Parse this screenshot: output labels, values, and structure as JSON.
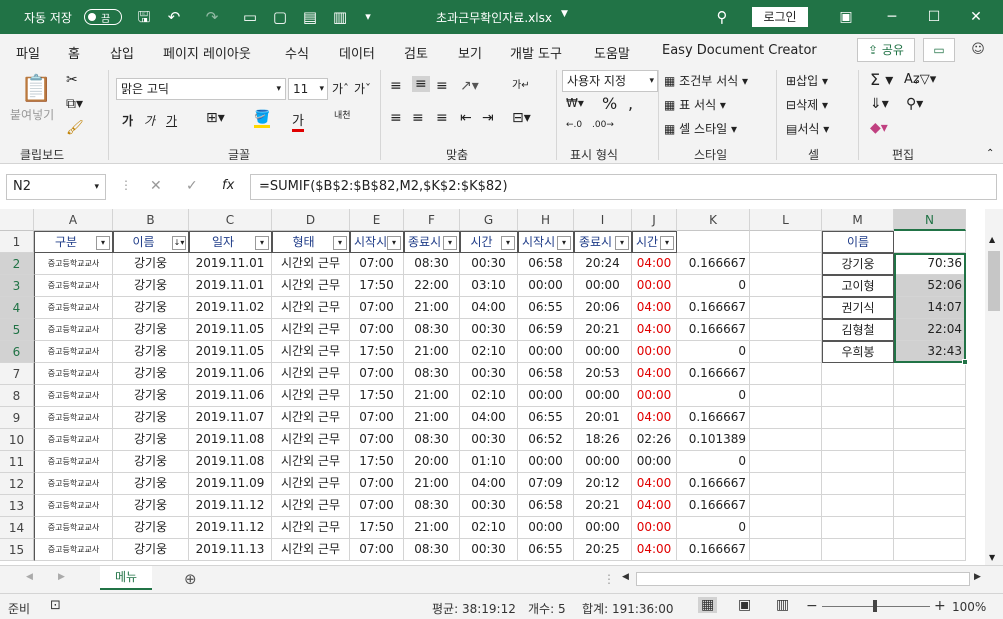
{
  "titlebar": {
    "autosave_label": "자동 저장",
    "autosave_state": "끔",
    "filename": "초과근무확인자료.xlsx",
    "login": "로그인"
  },
  "tabs": [
    "파일",
    "홈",
    "삽입",
    "페이지 레이아웃",
    "수식",
    "데이터",
    "검토",
    "보기",
    "개발 도구",
    "도움말",
    "Easy Document Creator"
  ],
  "share": "공유",
  "ribbon": {
    "paste": "붙여넣기",
    "font_name": "맑은 고딕",
    "font_size": "11",
    "bold": "가",
    "italic": "가",
    "underline": "가",
    "number_format": "사용자 지정",
    "cond_format": "조건부 서식",
    "table_format": "표 서식",
    "cell_style": "셀 스타일",
    "insert": "삽입",
    "delete": "삭제",
    "format": "서식",
    "groups": [
      "클립보드",
      "글꼴",
      "맞춤",
      "표시 형식",
      "스타일",
      "셀",
      "편집"
    ]
  },
  "formula": {
    "name_box": "N2",
    "content": "=SUMIF($B$2:$B$82,M2,$K$2:$K$82)"
  },
  "columns": [
    "A",
    "B",
    "C",
    "D",
    "E",
    "F",
    "G",
    "H",
    "I",
    "J",
    "K",
    "L",
    "M",
    "N"
  ],
  "headers": [
    "구분",
    "이름",
    "일자",
    "형태",
    "시작시",
    "종료시",
    "시간",
    "시작시",
    "종료시",
    "시간"
  ],
  "rows": [
    [
      "증고등학교교사",
      "강기웅",
      "2019.11.01",
      "시간외 근무",
      "07:00",
      "08:30",
      "00:30",
      "06:58",
      "20:24",
      "04:00",
      "0.166667"
    ],
    [
      "증고등학교교사",
      "강기웅",
      "2019.11.01",
      "시간외 근무",
      "17:50",
      "22:00",
      "03:10",
      "00:00",
      "00:00",
      "00:00",
      "0"
    ],
    [
      "증고등학교교사",
      "강기웅",
      "2019.11.02",
      "시간외 근무",
      "07:00",
      "21:00",
      "04:00",
      "06:55",
      "20:06",
      "04:00",
      "0.166667"
    ],
    [
      "증고등학교교사",
      "강기웅",
      "2019.11.05",
      "시간외 근무",
      "07:00",
      "08:30",
      "00:30",
      "06:59",
      "20:21",
      "04:00",
      "0.166667"
    ],
    [
      "증고등학교교사",
      "강기웅",
      "2019.11.05",
      "시간외 근무",
      "17:50",
      "21:00",
      "02:10",
      "00:00",
      "00:00",
      "00:00",
      "0"
    ],
    [
      "증고등학교교사",
      "강기웅",
      "2019.11.06",
      "시간외 근무",
      "07:00",
      "08:30",
      "00:30",
      "06:58",
      "20:53",
      "04:00",
      "0.166667"
    ],
    [
      "증고등학교교사",
      "강기웅",
      "2019.11.06",
      "시간외 근무",
      "17:50",
      "21:00",
      "02:10",
      "00:00",
      "00:00",
      "00:00",
      "0"
    ],
    [
      "증고등학교교사",
      "강기웅",
      "2019.11.07",
      "시간외 근무",
      "07:00",
      "21:00",
      "04:00",
      "06:55",
      "20:01",
      "04:00",
      "0.166667"
    ],
    [
      "증고등학교교사",
      "강기웅",
      "2019.11.08",
      "시간외 근무",
      "07:00",
      "08:30",
      "00:30",
      "06:52",
      "18:26",
      "02:26",
      "0.101389"
    ],
    [
      "증고등학교교사",
      "강기웅",
      "2019.11.08",
      "시간외 근무",
      "17:50",
      "20:00",
      "01:10",
      "00:00",
      "00:00",
      "00:00",
      "0"
    ],
    [
      "증고등학교교사",
      "강기웅",
      "2019.11.09",
      "시간외 근무",
      "07:00",
      "21:00",
      "04:00",
      "07:09",
      "20:12",
      "04:00",
      "0.166667"
    ],
    [
      "증고등학교교사",
      "강기웅",
      "2019.11.12",
      "시간외 근무",
      "07:00",
      "08:30",
      "00:30",
      "06:58",
      "20:21",
      "04:00",
      "0.166667"
    ],
    [
      "증고등학교교사",
      "강기웅",
      "2019.11.12",
      "시간외 근무",
      "17:50",
      "21:00",
      "02:10",
      "00:00",
      "00:00",
      "00:00",
      "0"
    ],
    [
      "증고등학교교사",
      "강기웅",
      "2019.11.13",
      "시간외 근무",
      "07:00",
      "08:30",
      "00:30",
      "06:55",
      "20:25",
      "04:00",
      "0.166667"
    ]
  ],
  "red_j": [
    true,
    true,
    true,
    true,
    true,
    true,
    true,
    true,
    false,
    false,
    true,
    true,
    true,
    true
  ],
  "summary": {
    "header": "이름",
    "names": [
      "강기웅",
      "고이형",
      "권기식",
      "김형철",
      "우희봉"
    ],
    "totals": [
      "70:36",
      "52:06",
      "14:07",
      "22:04",
      "32:43"
    ]
  },
  "sheet_tab": "메뉴",
  "status": {
    "mode": "준비",
    "average": "평균: 38:19:12",
    "count": "개수: 5",
    "sum": "합계: 191:36:00",
    "zoom": "100%"
  }
}
